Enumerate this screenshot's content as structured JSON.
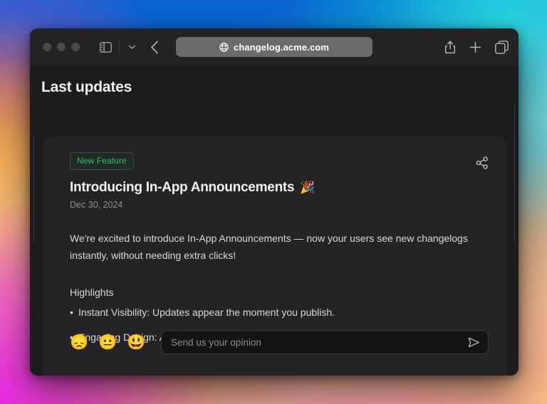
{
  "browser": {
    "address": "changelog.acme.com",
    "icons": {
      "globe": "globe-icon",
      "sidebar": "sidebar-toggle-icon",
      "chevron_down": "chevron-down-icon",
      "back": "back-arrow-icon",
      "share": "share-icon",
      "new_tab": "plus-icon",
      "tab_overview": "tab-overview-icon"
    },
    "traffic_lights": [
      "close",
      "minimize",
      "zoom"
    ]
  },
  "page": {
    "title": "Last updates"
  },
  "card": {
    "badge": "New Feature",
    "title": "Introducing In-App Announcements",
    "title_emoji": "🎉",
    "date": "Dec 30, 2024",
    "intro": "We're excited to introduce In-App Announcements — now your users see new changelogs instantly, without needing extra clicks!",
    "highlights_heading": "Highlights",
    "highlights": [
      "Instant Visibility: Updates appear the moment you publish.",
      "Engaging Design: A clean, eye-catching popup."
    ],
    "share_icon": "share-icon"
  },
  "feedback": {
    "reactions": [
      {
        "emoji": "😞",
        "name": "reaction-sad"
      },
      {
        "emoji": "😐",
        "name": "reaction-neutral"
      },
      {
        "emoji": "😃",
        "name": "reaction-happy"
      }
    ],
    "input_placeholder": "Send us your opinion",
    "input_value": "",
    "send_icon": "send-icon"
  },
  "colors": {
    "accent_green": "#2fbf6a",
    "window_bg": "#1c1c1e",
    "card_bg": "#242426",
    "toolbar_bg": "#232325",
    "address_bg": "#6b6b6e"
  }
}
